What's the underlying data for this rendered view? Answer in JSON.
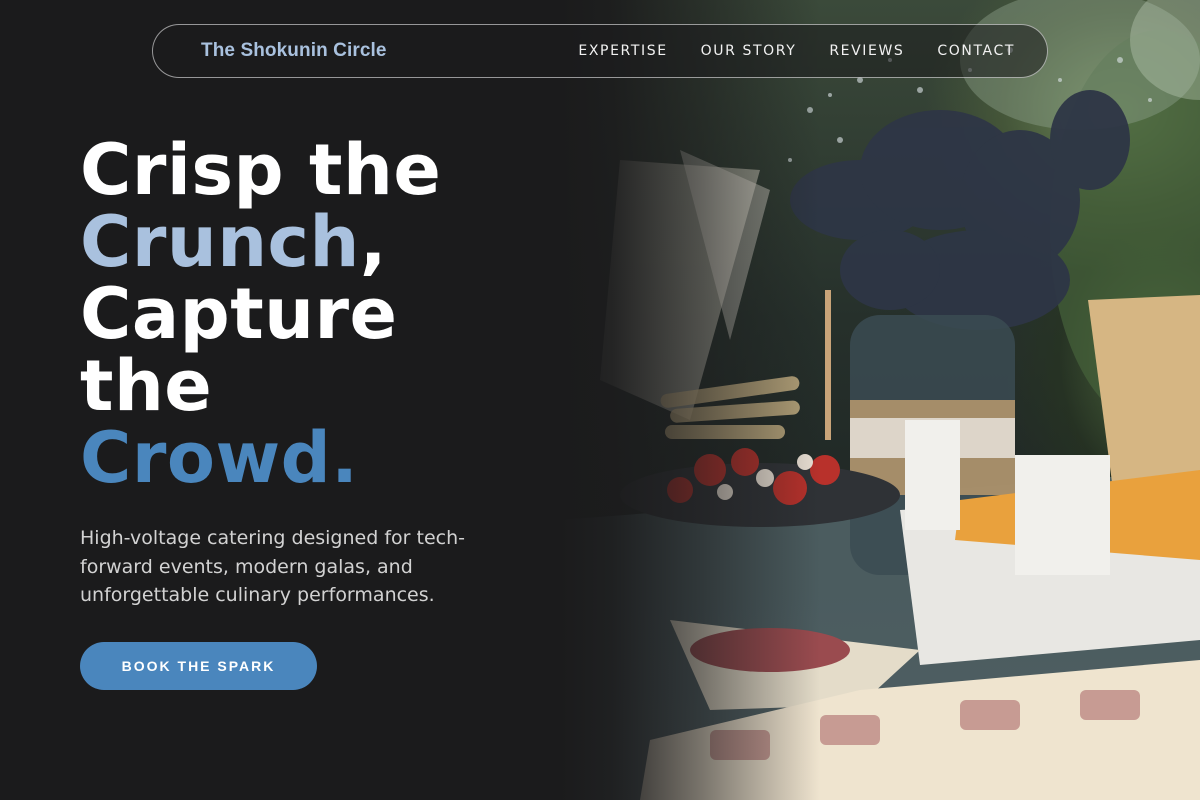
{
  "nav": {
    "brand": "The Shokunin Circle",
    "links": [
      "EXPERTISE",
      "OUR STORY",
      "REVIEWS",
      "CONTACT"
    ]
  },
  "hero": {
    "headline": {
      "line1": "Crisp the",
      "line2_accent": "Crunch",
      "line2_punct": ",",
      "line3": "Capture",
      "line4": "the",
      "line5_accent": "Crowd."
    },
    "subtitle": "High-voltage catering designed for tech-forward events, modern galas, and unforgettable culinary performances.",
    "cta_label": "BOOK THE SPARK"
  },
  "image": {
    "subject": "catering table with flowers in a jar, tomatoes, cured meats and sandwiches"
  },
  "colors": {
    "background": "#1b1b1c",
    "accent_light": "#a9c1de",
    "accent_blue": "#4a86bd"
  }
}
